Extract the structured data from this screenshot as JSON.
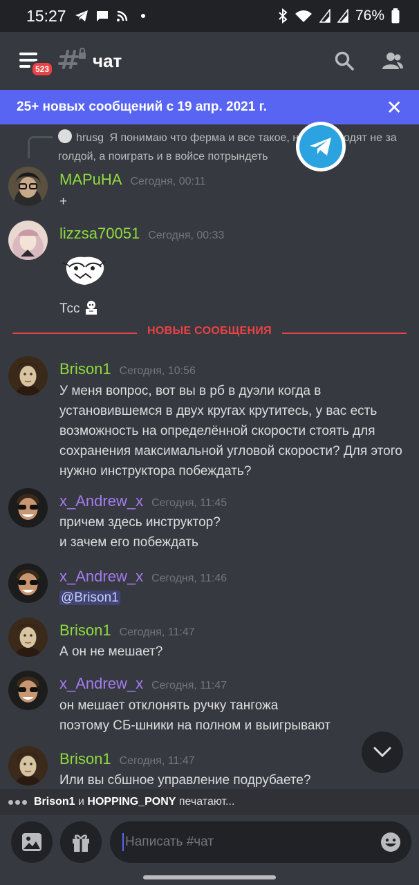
{
  "status_bar": {
    "time": "15:27",
    "battery": "76%"
  },
  "header": {
    "badge_count": "523",
    "channel_name": "чат"
  },
  "banner": {
    "text": "25+ новых сообщений с 19 апр. 2021 г."
  },
  "reply_preview": {
    "author": "hrusg",
    "text": "Я понимаю что ферма и все такое, но люди ходят не за голдой, а поиграть и в войсе потрындеть"
  },
  "messages": [
    {
      "author": "MAPuHA",
      "time": "Сегодня, 00:11",
      "lines": [
        "+"
      ]
    },
    {
      "author": "lizzsa70051",
      "time": "Сегодня, 00:33",
      "lines": [
        "Тсс"
      ]
    },
    {
      "author": "Brison1",
      "time": "Сегодня, 10:56",
      "lines": [
        "У меня вопрос, вот вы в рб в дуэли когда в",
        "установившемся в двух кругах крутитесь, у вас есть",
        "возможность  на определённой скорости стоять для",
        "сохранения максимальной угловой скорости? Для этого",
        "нужно инструктора побеждать?"
      ]
    },
    {
      "author": "x_Andrew_x",
      "time": "Сегодня, 11:45",
      "lines": [
        "причем здесь инструктор?",
        "и зачем его побеждать"
      ]
    },
    {
      "author": "x_Andrew_x",
      "time": "Сегодня, 11:46",
      "lines": [
        "@Brison1"
      ]
    },
    {
      "author": "Brison1",
      "time": "Сегодня, 11:47",
      "lines": [
        "А он не мешает?"
      ]
    },
    {
      "author": "x_Andrew_x",
      "time": "Сегодня, 11:47",
      "lines": [
        "он мешает отклонять ручку тангожа",
        "поэтому СБ-шники на полном и выигрывают"
      ]
    },
    {
      "author": "Brison1",
      "time": "Сегодня, 11:47",
      "lines": [
        "Или вы сбшное управление подрубаете?"
      ]
    }
  ],
  "new_messages_divider": "НОВЫЕ СООБЩЕНИЯ",
  "typing": {
    "user1": "Brison1",
    "conj": " и ",
    "user2": "HOPPING_PONY",
    "suffix": " печатают..."
  },
  "input": {
    "placeholder": "Написать #чат"
  },
  "colors": {
    "background": "#36393f",
    "banner": "#5865f2",
    "new_divider": "#ed4245",
    "green_user": "#8fdb3f",
    "purple_user": "#a67bf0"
  }
}
